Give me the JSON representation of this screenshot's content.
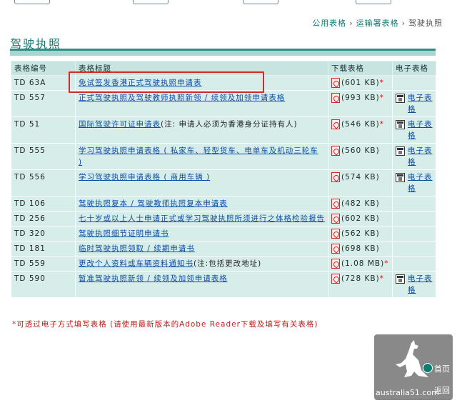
{
  "breadcrumb": {
    "item1": "公用表格",
    "item2": "运输署表格",
    "current": "驾驶执照",
    "sep": "›"
  },
  "page_title": "驾驶执照",
  "table": {
    "headers": [
      "表格编号",
      "表格标题",
      "下载表格",
      "电子表格"
    ],
    "rows": [
      {
        "code": "TD 63A",
        "title": "免试签发香港正式驾驶执照申请表",
        "note": "",
        "size": "(601 KB)",
        "asterisk": "*",
        "eform": ""
      },
      {
        "code": "TD 557",
        "title": "正式驾驶执照及驾驶教师执照新领 / 续领及加领申请表格",
        "note": "",
        "size": "(993 KB)",
        "asterisk": "*",
        "eform": "电子表格"
      },
      {
        "code": "TD 51",
        "title": "国际驾驶许可证申请表",
        "note": "(注: 申请人必须为香港身分证持有人)",
        "size": "(546 KB)",
        "asterisk": "*",
        "eform": "电子表格"
      },
      {
        "code": "TD 555",
        "title": "学习驾驶执照申请表格 ( 私家车、轻型货车、电单车及机动三轮车 )",
        "note": "",
        "size": "(560 KB)",
        "asterisk": "",
        "eform": "电子表格"
      },
      {
        "code": "TD 556",
        "title": "学习驾驶执照申请表格 ( 商用车辆 )",
        "note": "",
        "size": "(574 KB)",
        "asterisk": "",
        "eform": "电子表格"
      },
      {
        "code": "TD 106",
        "title": "驾驶执照复本 / 驾驶教师执照复本申请表",
        "note": "",
        "size": "(482 KB)",
        "asterisk": "",
        "eform": ""
      },
      {
        "code": "TD 256",
        "title": "七十岁或以上人士申请正式或学习驾驶执照所须进行之体格检验报告",
        "note": "",
        "size": "(602 KB)",
        "asterisk": "",
        "eform": ""
      },
      {
        "code": "TD 320",
        "title": "驾驶执照细节证明申请书",
        "note": "",
        "size": "(562 KB)",
        "asterisk": "",
        "eform": ""
      },
      {
        "code": "TD 181",
        "title": "临时驾驶执照领取 / 续期申请书",
        "note": "",
        "size": "(698 KB)",
        "asterisk": "",
        "eform": ""
      },
      {
        "code": "TD 559",
        "title": "更改个人资料或车辆资料通知书",
        "note": "(注:包括更改地址)",
        "size": "(1.08 MB)",
        "asterisk": "*",
        "eform": ""
      },
      {
        "code": "TD 590",
        "title": "暂准驾驶执照新领 / 续领及加领申请表格",
        "note": "",
        "size": "(728 KB)",
        "asterisk": "*",
        "eform": "电子表格"
      }
    ]
  },
  "footnote": "*可透过电子方式填写表格 (请使用最新版本的Adobe Reader下载及填写有关表格)",
  "watermark": {
    "text": "australia51.com",
    "home": "首页",
    "back": "返回"
  },
  "colors": {
    "accent": "#0b7d73",
    "row_bg": "#d7edea",
    "header_bg": "#c8e4e0",
    "highlight": "#d42a2a",
    "asterisk": "#d01818"
  }
}
